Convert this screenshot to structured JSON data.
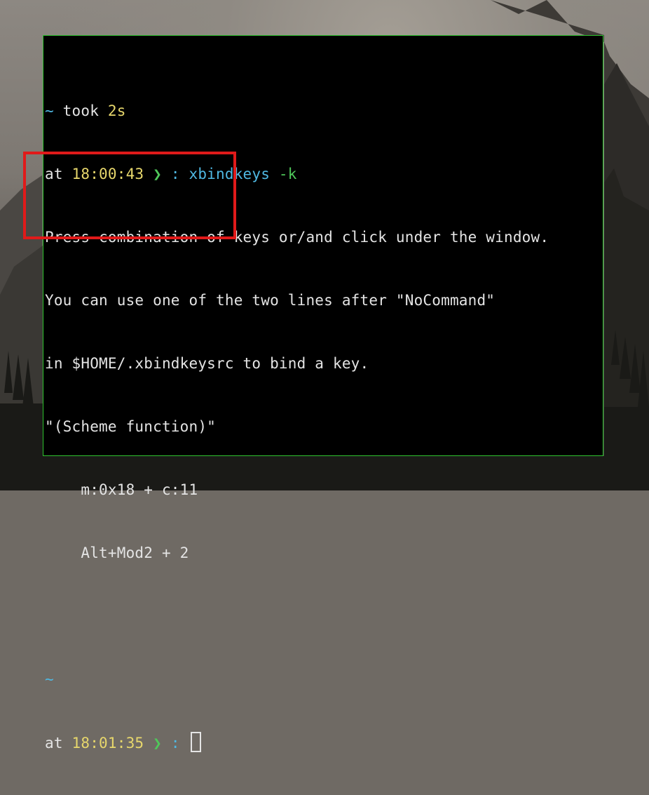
{
  "terminal": {
    "lines": [
      {
        "cwd": "~",
        "took_label": " took ",
        "took_value": "2s"
      },
      {
        "at_label": "at ",
        "time": "18:00:43",
        "arrow": " ❯ ",
        "colon": ": ",
        "command": "xbindkeys",
        "flag": " -k"
      },
      {
        "text": "Press combination of keys or/and click under the window."
      },
      {
        "text": "You can use one of the two lines after \"NoCommand\""
      },
      {
        "text": "in $HOME/.xbindkeysrc to bind a key."
      },
      {
        "text": "\"(Scheme function)\""
      },
      {
        "text": "    m:0x18 + c:11"
      },
      {
        "text": "    Alt+Mod2 + 2"
      },
      {
        "text": ""
      },
      {
        "cwd": "~"
      },
      {
        "at_label": "at ",
        "time": "18:01:35",
        "arrow": " ❯ ",
        "colon": ": "
      }
    ]
  },
  "colors": {
    "border": "#2fc42f",
    "highlight": "#e01a1a",
    "cyan": "#4fb8e2",
    "yellow": "#e7d76c",
    "green": "#4fc85a"
  }
}
